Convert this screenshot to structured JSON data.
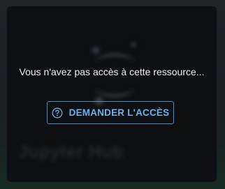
{
  "app": {
    "name": "Jupyter Hub",
    "logo_icon": "jupyter-logo-icon"
  },
  "access": {
    "message": "Vous n'avez pas accès à cette ressource...",
    "button_label": "DEMANDER L'ACCÈS",
    "button_icon": "question-circle-icon"
  },
  "colors": {
    "accent": "#6eb2e8",
    "button_border": "#4b8fc7",
    "message_text": "#f2f2f2",
    "card_background": "#101214"
  }
}
